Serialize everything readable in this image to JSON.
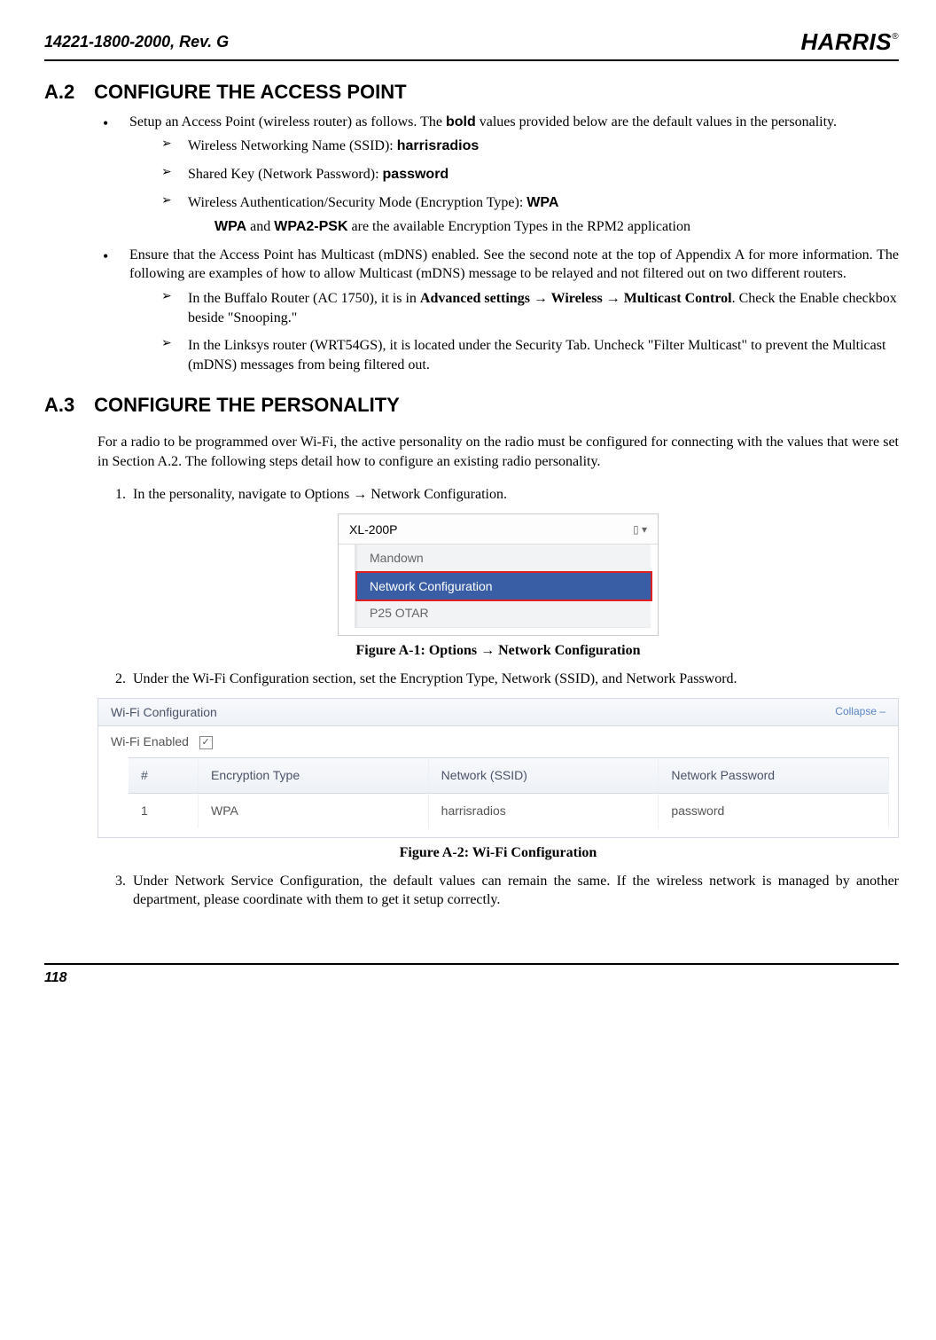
{
  "header": {
    "doc_id": "14221-1800-2000, Rev. G",
    "logo": "HARRIS"
  },
  "sections": {
    "a2": {
      "num": "A.2",
      "title": "CONFIGURE THE ACCESS POINT",
      "bullet1": "Setup an Access Point (wireless router) as follows.  The ",
      "bullet1_bold": "bold",
      "bullet1_end": " values provided below are the default values in the personality.",
      "ssid_label": "Wireless Networking Name (SSID): ",
      "ssid_value": "harrisradios",
      "key_label": "Shared Key (Network Password): ",
      "key_value": "password",
      "auth_label": "Wireless Authentication/Security Mode (Encryption Type): ",
      "auth_value": "WPA",
      "enc_note_1": "WPA",
      "enc_note_mid": " and ",
      "enc_note_2": "WPA2-PSK",
      "enc_note_end": " are the available Encryption Types in the RPM2 application",
      "bullet2": "Ensure that the Access Point has Multicast (mDNS) enabled.  See the second note at the top of Appendix A for more information.  The following are examples of how to allow Multicast (mDNS) message to be relayed and not filtered out on two different routers.",
      "buffalo_a": "In the Buffalo Router (AC 1750), it is in ",
      "buffalo_b": "Advanced settings → Wireless → Multicast Control",
      "buffalo_c": ". Check the Enable checkbox beside \"Snooping.\"",
      "linksys": "In the Linksys router (WRT54GS), it is located under the Security Tab. Uncheck \"Filter Multicast\" to prevent the Multicast (mDNS) messages from being filtered out."
    },
    "a3": {
      "num": "A.3",
      "title": "CONFIGURE THE PERSONALITY",
      "intro": "For a radio to be programmed over Wi-Fi, the active personality on the radio must be configured for connecting with the values that were set in Section A.2.  The following steps detail how to configure an existing radio personality.",
      "step1": "In the personality, navigate to Options → Network Configuration.",
      "step2": "Under the Wi-Fi Configuration section, set the Encryption Type, Network (SSID), and Network Password.",
      "step3": "Under Network Service Configuration, the default values can remain the same.  If the wireless network is managed by another department, please coordinate with them to get it setup correctly."
    }
  },
  "figures": {
    "f1": {
      "device": "XL-200P",
      "menu": [
        "Mandown",
        "Network Configuration",
        "P25 OTAR"
      ],
      "selected_index": 1,
      "caption": "Figure A-1: Options → Network Configuration"
    },
    "f2": {
      "panel_title": "Wi-Fi Configuration",
      "collapse": "Collapse   –",
      "wifi_enabled_label": "Wi-Fi Enabled",
      "wifi_enabled_checked": "✓",
      "columns": [
        "#",
        "Encryption Type",
        "Network (SSID)",
        "Network Password"
      ],
      "row": [
        "1",
        "WPA",
        "harrisradios",
        "password"
      ],
      "caption": "Figure A-2: Wi-Fi Configuration"
    }
  },
  "footer": {
    "page": "118"
  }
}
